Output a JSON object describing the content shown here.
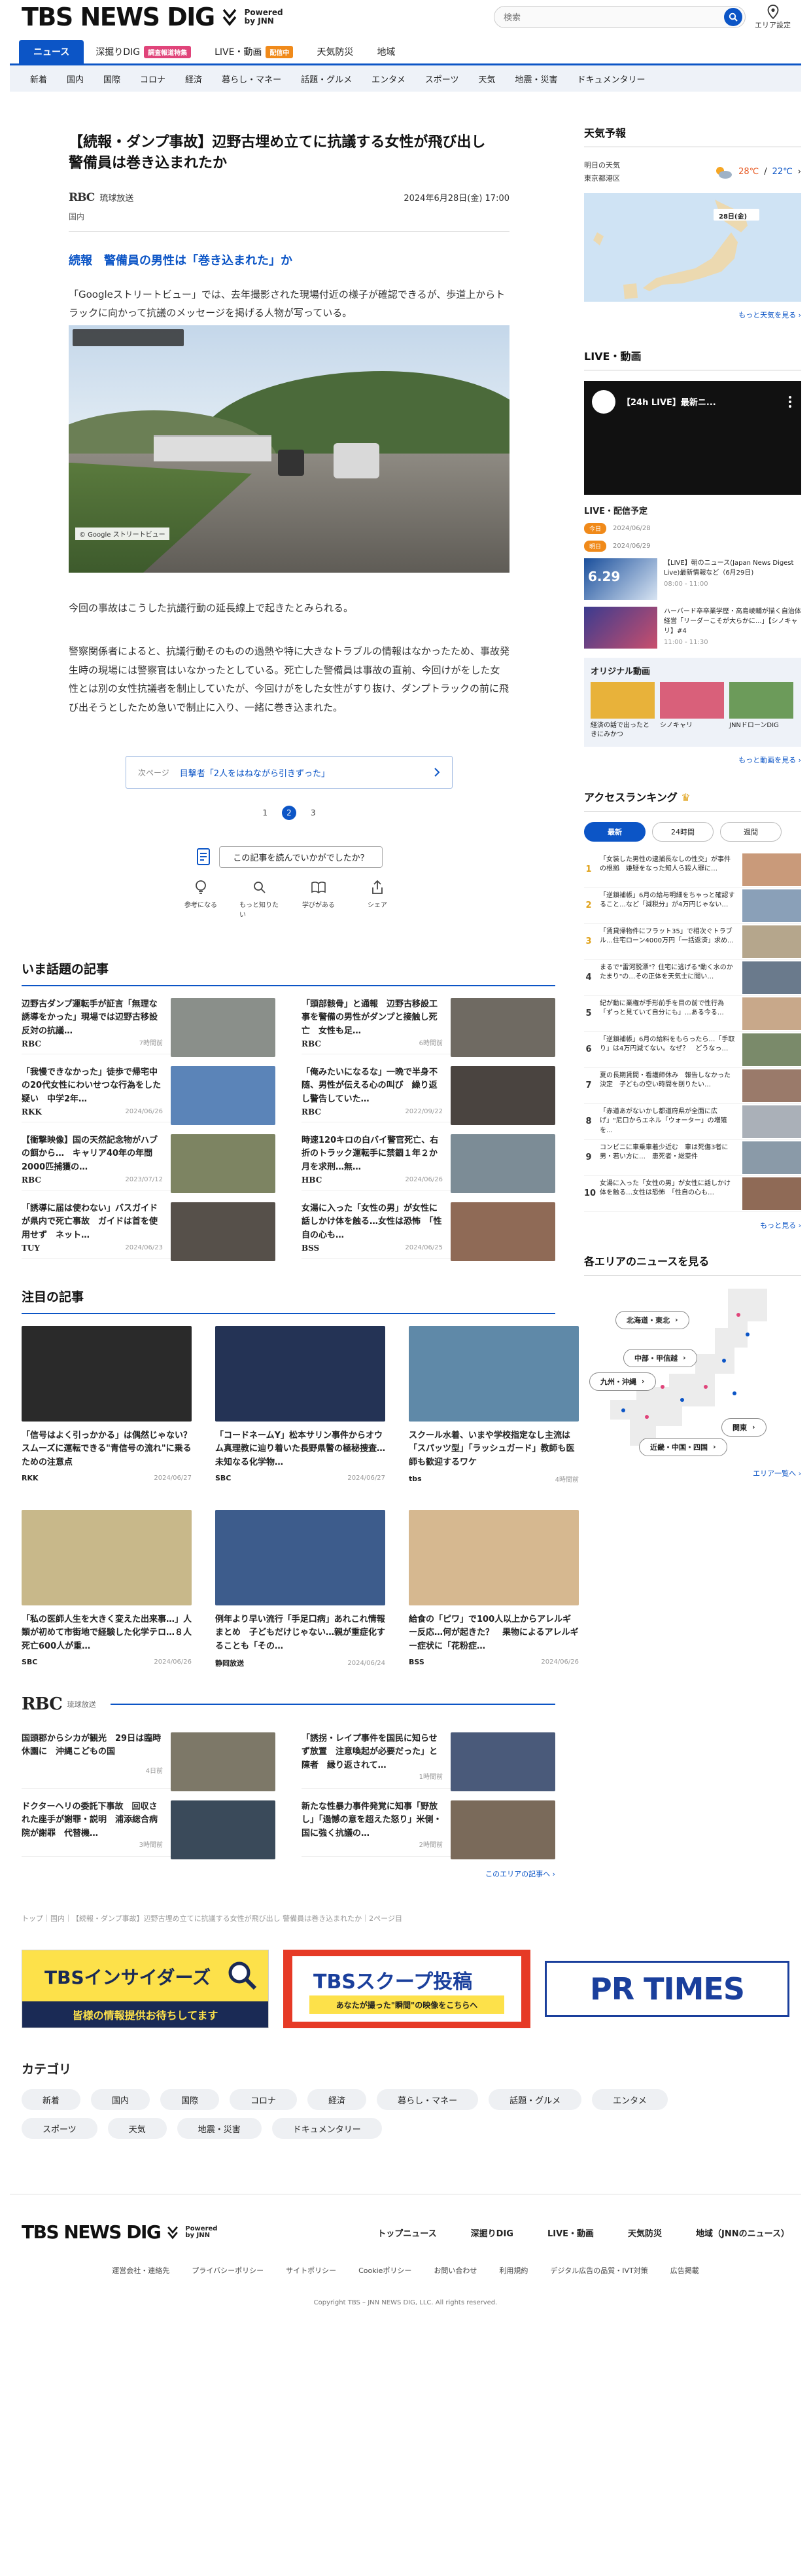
{
  "header": {
    "logo_text": "TBS NEWS DIG",
    "powered_line1": "Powered",
    "powered_line2": "by JNN",
    "search_placeholder": "検索",
    "area_label": "エリア設定"
  },
  "gnav": [
    {
      "label": "ニュース",
      "active": true
    },
    {
      "label": "深掘りDIG",
      "tag": "調査報道特集"
    },
    {
      "label": "LIVE・動画",
      "tag": "配信中"
    },
    {
      "label": "天気防災"
    },
    {
      "label": "地域"
    }
  ],
  "subnav": [
    "新着",
    "国内",
    "国際",
    "コロナ",
    "経済",
    "暮らし・マネー",
    "話題・グルメ",
    "エンタメ",
    "スポーツ",
    "天気",
    "地震・災害",
    "ドキュメンタリー"
  ],
  "article": {
    "title": "【続報・ダンプ事故】辺野古埋め立てに抗議する女性が飛び出し　警備員は巻き込まれたか",
    "source_logo": "RBC",
    "source_name": "琉球放送",
    "date": "2024年6月28日(金) 17:00",
    "category": "国内",
    "subtitle": "続報　警備員の男性は「巻き込まれた」か",
    "p1": "「Googleストリートビュー」では、去年撮影された現場付近の様子が確認できるが、歩道上からトラックに向かって抗議のメッセージを掲げる人物が写っている。",
    "image_caption": "© Google ストリートビュー",
    "p2": "今回の事故はこうした抗議行動の延長線上で起きたとみられる。",
    "p3": "警察関係者によると、抗議行動そのものの過熱や特に大きなトラブルの情報はなかったため、事故発生時の現場には警察官はいなかったとしている。死亡した警備員は事故の直前、今回けがをした女性とは別の女性抗議者を制止していたが、今回けがをした女性がすり抜け、ダンプトラックの前に飛び出そうとしたため急いで制止に入り、一緒に巻き込まれた。",
    "next_label": "次ページ",
    "next_text": "目撃者「2人をはねながら引きずった」",
    "pages": [
      "1",
      "2",
      "3"
    ],
    "current_page": 2,
    "feedback_q": "この記事を読んでいかがでしたか？",
    "reactions": [
      "参考になる",
      "もっと知りたい",
      "学びがある",
      "シェア"
    ]
  },
  "hot": {
    "title": "いま話題の記事",
    "items": [
      {
        "text": "辺野古ダンプ運転手が証言「無理な誘導をかった」現場では辺野古移設反対の抗議…",
        "station": "RBC",
        "date": "7時間前",
        "color": "#8a8f8a"
      },
      {
        "text": "「頭部骸骨」と通報　辺野古移設工事を警備の男性がダンプと接触し死亡　女性も足…",
        "station": "RBC",
        "date": "6時間前",
        "color": "#6f6a62"
      },
      {
        "text": "「我慢できなかった」徒歩で帰宅中の20代女性にわいせつな行為をした疑い　中学2年…",
        "station": "RKK",
        "date": "2024/06/26",
        "color": "#5b84b8"
      },
      {
        "text": "「俺みたいになるな」一晩で半身不随、男性が伝える心の叫び　繰り返し警告していた…",
        "station": "RBC",
        "date": "2022/09/22",
        "color": "#4a4440"
      },
      {
        "text": "【衝撃映像】国の天然記念物がハブの餌から…　キャリア40年の年間2000匹捕獲の…",
        "station": "RBC",
        "date": "2023/07/12",
        "color": "#7d8462"
      },
      {
        "text": "時速120キロの白バイ警官死亡、右折のトラック運転手に禁錮１年２か月を求刑…無…",
        "station": "HBC",
        "date": "2024/06/26",
        "color": "#7c8c96"
      },
      {
        "text": "「誘導に届は使わない」バスガイドが県内で死亡事故　ガイドは首を使用せず　ネット…",
        "station": "TUY",
        "date": "2024/06/23",
        "color": "#56504a"
      },
      {
        "text": "女湯に入った「女性の男」が女性に話しかけ体を触る…女性は恐怖　「性自の心も…",
        "station": "BSS",
        "date": "2024/06/25",
        "color": "#8f6a56"
      }
    ]
  },
  "featured": {
    "title": "注目の記事",
    "items": [
      {
        "text": "「信号はよく引っかかる」は偶然じゃない？スムーズに運転できる\"青信号の流れ\"に乗るための注意点",
        "station": "RKK",
        "date": "2024/06/27",
        "color": "#2a2a2a"
      },
      {
        "text": "「コードネームY」松本サリン事件からオウム真理教に辿り着いた長野県警の極秘捜査…未知なる化学物…",
        "station": "SBC",
        "date": "2024/06/27",
        "color": "#243355"
      },
      {
        "text": "スクール水着、いまや学校指定なし主流は「スパッツ型」「ラッシュガード」教師も医師も歓迎するワケ",
        "station": "tbs",
        "date": "4時間前",
        "color": "#5f89a8"
      },
      {
        "text": "「私の医師人生を大きく変えた出来事…」人類が初めて市街地で経験した化学テロ…８人死亡600人が重…",
        "station": "SBC",
        "date": "2024/06/26",
        "color": "#c8b88a"
      },
      {
        "text": "例年より早い流行「手足口病」あれこれ情報まとめ　子どもだけじゃない…親が重症化することも「その…",
        "station": "静岡放送",
        "date": "2024/06/24",
        "color": "#3d5c8c"
      },
      {
        "text": "給食の「ピワ」で100人以上からアレルギー反応…何が起きた？　果物によるアレルギー症状に「花粉症…",
        "station": "BSS",
        "date": "2024/06/26",
        "color": "#d6b890"
      }
    ]
  },
  "rbc": {
    "logo": "RBC",
    "name": "琉球放送",
    "items": [
      {
        "text": "国頭郡から​シカが観光　29日は臨時休園に　沖縄こどもの国",
        "date": "4日前",
        "color": "#7d7868"
      },
      {
        "text": "「誘拐・レイプ事件を国民に知らせず放置　注意喚起が必要だった」と陳者　縁り返されて…",
        "date": "1時間前",
        "color": "#4a5a7a"
      },
      {
        "text": "ドクターヘリの委託下事故　回収された座手が謝罪・説明　浦添総合病院が謝罪　代替機…",
        "date": "3時間前",
        "color": "#3a4a5a"
      },
      {
        "text": "新たな性暴力事件発覚に知事「野放し」「過憾の意を超えた怒り」米側・国に強く抗議の…",
        "date": "2時間前",
        "color": "#7a6a5a"
      }
    ],
    "more": "このエリアの記事へ"
  },
  "breadcrumb": "トップ｜国内｜【続報・ダンプ事故】辺野古埋め立てに抗議する女性が飛び出し 警備員は巻き込まれたか｜2ページ目",
  "banners": [
    {
      "title": "TBSインサイダーズ",
      "sub": "皆様の情報提供お待ちしてます"
    },
    {
      "title": "TBSスクープ投稿",
      "sub": "あなたが撮った\"瞬間\"の映像をこちらへ"
    },
    {
      "title": "PR TIMES"
    }
  ],
  "categories": {
    "title": "カテゴリ",
    "items": [
      "新着",
      "国内",
      "国際",
      "コロナ",
      "経済",
      "暮らし・マネー",
      "話題・グルメ",
      "エンタメ",
      "スポーツ",
      "天気",
      "地震・災害",
      "ドキュメンタリー"
    ]
  },
  "footer": {
    "links": [
      "トップニュース",
      "深掘りDIG",
      "LIVE・動画",
      "天気防災",
      "地域（JNNのニュース）"
    ],
    "sub": [
      "運営会社・連絡先",
      "プライバシーポリシー",
      "サイトポリシー",
      "Cookieポリシー",
      "お問い合わせ",
      "利用規約",
      "デジタル広告の品質・IVT対策",
      "広告掲載"
    ],
    "copyright": "Copyright TBS – JNN NEWS DIG, LLC. All rights reserved."
  },
  "side": {
    "weather_title": "天気予報",
    "weather_when": "明日の天気",
    "weather_area": "東京都港区",
    "temp_hi": "28℃",
    "temp_lo": "22℃",
    "map_label": "28日(金)",
    "weather_more": "もっと天気を見る",
    "live_title": "LIVE・動画",
    "live_video": "【24h LIVE】最新ニ...",
    "sched_title": "LIVE・配信予定",
    "sched_rows": [
      {
        "pill": "今日",
        "date": "2024/06/28"
      },
      {
        "pill": "明日",
        "date": "2024/06/29"
      }
    ],
    "sched_items": [
      {
        "badge": "6.29",
        "text": "【LIVE】朝のニュース(Japan News Digest Live)最新情報など（6月29日)",
        "time": "08:00 - 11:00"
      },
      {
        "badge": "",
        "text": "ハーバード卒卒業学歴・高島崚輔が描く自治体経営「リーダーこそが大らかに...」【シノキャリ】#4",
        "time": "11:00 - 11:30"
      }
    ],
    "orig_title": "オリジナル動画",
    "orig_items": [
      "経済の話で出ったときにみかつ",
      "シノキャリ",
      "JNNドローンDIG"
    ],
    "video_more": "もっと動画を見る",
    "ranking_title": "アクセスランキング",
    "ranking_tabs": [
      "最新",
      "24時間",
      "週間"
    ],
    "ranking": [
      "「女装した男性の逮捕長なしの性交」が事件の根拠　嫌疑をなった知人ら殺人罪に…",
      "「逆鎖補帳」6月の給与明細をちゃっと確認すること…など「減税分」が4万円じゃない…",
      "「賃貸帰物件にフラット35」で相次ぐトラブル…住宅ローン4000万円「一括返済」求め…",
      "まるで\"雷河脱漂\"？住宅に逃げる\"動く水のかたまり\"の…その正体を天気士に聞い…",
      "紀が動に業権が手形前手を目の前で性行為「ずっと見ていて自分にも」…ある今る…",
      "「逆鎖補帳」6月の給料をもらったら…「手取り」は4万円減てない。なぜ？　どうなっ…",
      "夏の長期賃間・看護師休み　報告しなかった決定　子どもの空い時間を削りたい…",
      "「赤道あがないかし都道府県が全面に広げ」\"尼口からエネル「ウォーター」の増殖を…",
      "コンビニに車乗車着少近む　車は死傷3者に　男・若い方に…　患死者・総菜件",
      "女湯に入った「女性の男」が女性に話しかけ体を触る…女性は恐怖　「性自の心も…"
    ],
    "ranking_more": "もっと見る",
    "area_title": "各エリアのニュースを見る",
    "areas": [
      "北海道・東北",
      "中部・甲信越",
      "九州・沖縄",
      "関東",
      "近畿・中国・四国"
    ],
    "area_more": "エリア一覧へ"
  }
}
